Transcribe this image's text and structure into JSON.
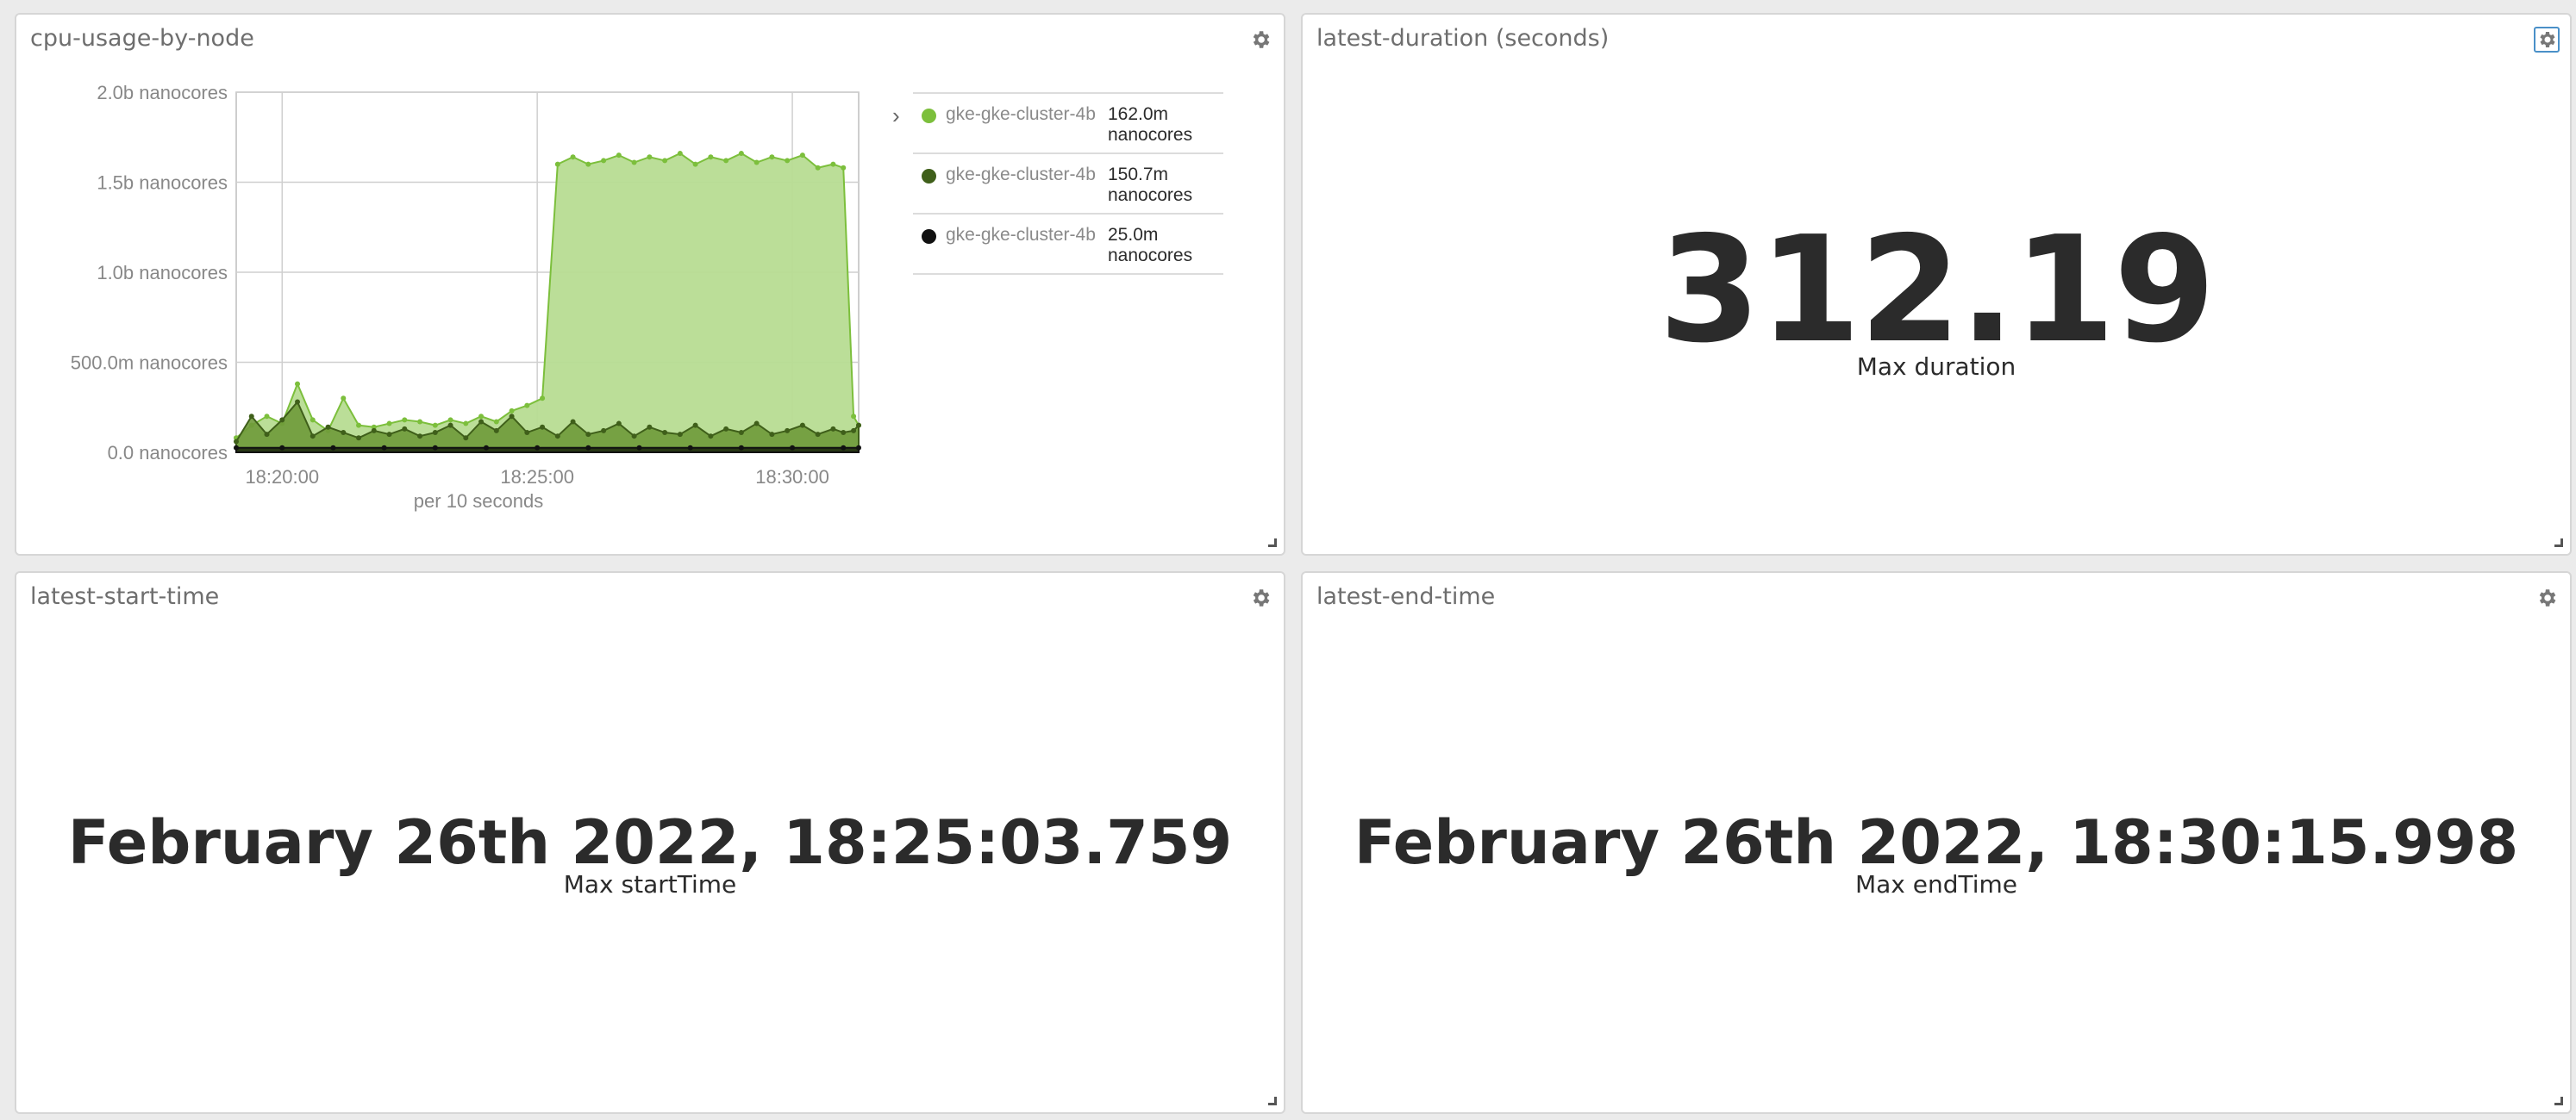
{
  "panels": {
    "cpu": {
      "title": "cpu-usage-by-node",
      "legend": [
        {
          "name": "gke-gke-cluster-4b",
          "value_line1": "162.0m",
          "value_line2": "nanocores",
          "color": "#7cbf3c"
        },
        {
          "name": "gke-gke-cluster-4b",
          "value_line1": "150.7m",
          "value_line2": "nanocores",
          "color": "#3f5f1a"
        },
        {
          "name": "gke-gke-cluster-4b",
          "value_line1": "25.0m",
          "value_line2": "nanocores",
          "color": "#111111"
        }
      ]
    },
    "duration": {
      "title": "latest-duration (seconds)",
      "value": "312.19",
      "label": "Max duration"
    },
    "start": {
      "title": "latest-start-time",
      "value": "February 26th 2022, 18:25:03.759",
      "label": "Max startTime"
    },
    "end": {
      "title": "latest-end-time",
      "value": "February 26th 2022, 18:30:15.998",
      "label": "Max endTime"
    }
  },
  "icons": {
    "settings": "gear-icon",
    "resize": "resize-handle-icon",
    "expand": "chevron-right-icon"
  },
  "chart_data": {
    "type": "area",
    "title": "cpu-usage-by-node",
    "xlabel": "per 10 seconds",
    "ylabel": "",
    "xticks": [
      "18:20:00",
      "18:25:00",
      "18:30:00"
    ],
    "yticks": [
      "0.0 nanocores",
      "500.0m nanocores",
      "1.0b nanocores",
      "1.5b nanocores",
      "2.0b nanocores"
    ],
    "ylim": [
      0,
      2000000000
    ],
    "x_range_minutes": [
      -5.9,
      6.3
    ],
    "x_unit": "minutes relative to 18:25:00",
    "colors": [
      "#b7dc92",
      "#6f9a3a",
      "#1f2a10"
    ],
    "series": [
      {
        "name": "gke-gke-cluster-4b",
        "color": "#7cbf3c",
        "x": [
          -5.9,
          -5.6,
          -5.3,
          -5.0,
          -4.7,
          -4.4,
          -4.1,
          -3.8,
          -3.5,
          -3.2,
          -2.9,
          -2.6,
          -2.3,
          -2.0,
          -1.7,
          -1.4,
          -1.1,
          -0.8,
          -0.5,
          -0.2,
          0.1,
          0.4,
          0.7,
          1.0,
          1.3,
          1.6,
          1.9,
          2.2,
          2.5,
          2.8,
          3.1,
          3.4,
          3.7,
          4.0,
          4.3,
          4.6,
          4.9,
          5.2,
          5.5,
          5.8,
          6.0,
          6.2,
          6.3
        ],
        "y": [
          80000000,
          150000000,
          200000000,
          160000000,
          380000000,
          180000000,
          120000000,
          300000000,
          150000000,
          140000000,
          160000000,
          180000000,
          170000000,
          150000000,
          180000000,
          160000000,
          200000000,
          170000000,
          230000000,
          260000000,
          300000000,
          1600000000,
          1640000000,
          1600000000,
          1620000000,
          1650000000,
          1610000000,
          1640000000,
          1620000000,
          1660000000,
          1600000000,
          1640000000,
          1620000000,
          1660000000,
          1610000000,
          1640000000,
          1620000000,
          1650000000,
          1580000000,
          1600000000,
          1580000000,
          200000000,
          150000000
        ]
      },
      {
        "name": "gke-gke-cluster-4b",
        "color": "#3f5f1a",
        "x": [
          -5.9,
          -5.6,
          -5.3,
          -5.0,
          -4.7,
          -4.4,
          -4.1,
          -3.8,
          -3.5,
          -3.2,
          -2.9,
          -2.6,
          -2.3,
          -2.0,
          -1.7,
          -1.4,
          -1.1,
          -0.8,
          -0.5,
          -0.2,
          0.1,
          0.4,
          0.7,
          1.0,
          1.3,
          1.6,
          1.9,
          2.2,
          2.5,
          2.8,
          3.1,
          3.4,
          3.7,
          4.0,
          4.3,
          4.6,
          4.9,
          5.2,
          5.5,
          5.8,
          6.0,
          6.2,
          6.3
        ],
        "y": [
          60000000,
          200000000,
          100000000,
          180000000,
          280000000,
          90000000,
          140000000,
          110000000,
          80000000,
          120000000,
          100000000,
          130000000,
          90000000,
          110000000,
          150000000,
          80000000,
          170000000,
          120000000,
          200000000,
          110000000,
          140000000,
          90000000,
          170000000,
          100000000,
          120000000,
          160000000,
          90000000,
          140000000,
          110000000,
          100000000,
          150000000,
          90000000,
          130000000,
          110000000,
          160000000,
          100000000,
          120000000,
          150000000,
          100000000,
          130000000,
          110000000,
          120000000,
          150000000
        ]
      },
      {
        "name": "gke-gke-cluster-4b",
        "color": "#111111",
        "x": [
          -5.9,
          -5.0,
          -4.0,
          -3.0,
          -2.0,
          -1.0,
          0.0,
          1.0,
          2.0,
          3.0,
          4.0,
          5.0,
          6.0,
          6.3
        ],
        "y": [
          25000000,
          25000000,
          25000000,
          25000000,
          25000000,
          25000000,
          25000000,
          25000000,
          25000000,
          25000000,
          25000000,
          25000000,
          25000000,
          25000000
        ]
      }
    ]
  }
}
